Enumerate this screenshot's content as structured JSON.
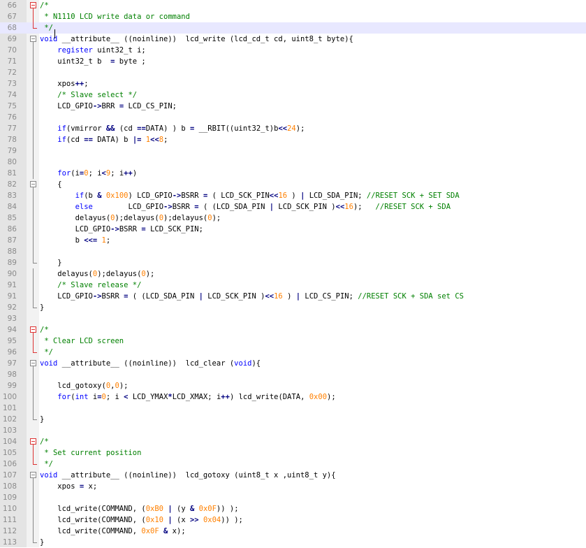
{
  "editor": {
    "lines": [
      {
        "n": "66",
        "fold": "start",
        "tokens": [
          [
            "cm",
            "/*"
          ]
        ]
      },
      {
        "n": "67",
        "fold": "mid",
        "tokens": [
          [
            "cm",
            " * N1110 LCD write data or command"
          ]
        ]
      },
      {
        "n": "68",
        "fold": "end",
        "current": true,
        "tokens": [
          [
            "cm",
            " */"
          ]
        ]
      },
      {
        "n": "69",
        "fold": "start",
        "g": true,
        "tokens": [
          [
            "kw",
            "void"
          ],
          [
            "pl",
            " __attribute__ ((noinline))  lcd_write (lcd_cd_t cd, uint8_t byte){"
          ]
        ]
      },
      {
        "n": "70",
        "fold": "mid",
        "g": true,
        "tokens": [
          [
            "pl",
            "    "
          ],
          [
            "kw",
            "register"
          ],
          [
            "pl",
            " uint32_t i;"
          ]
        ]
      },
      {
        "n": "71",
        "fold": "mid",
        "g": true,
        "tokens": [
          [
            "pl",
            "    uint32_t b  "
          ],
          [
            "op",
            "="
          ],
          [
            "pl",
            " byte ;"
          ]
        ]
      },
      {
        "n": "72",
        "fold": "mid",
        "g": true,
        "tokens": []
      },
      {
        "n": "73",
        "fold": "mid",
        "g": true,
        "tokens": [
          [
            "pl",
            "    xpos"
          ],
          [
            "op",
            "++"
          ],
          [
            "pl",
            ";"
          ]
        ]
      },
      {
        "n": "74",
        "fold": "mid",
        "g": true,
        "tokens": [
          [
            "pl",
            "    "
          ],
          [
            "cm",
            "/* Slave select */"
          ]
        ]
      },
      {
        "n": "75",
        "fold": "mid",
        "g": true,
        "tokens": [
          [
            "pl",
            "    LCD_GPIO"
          ],
          [
            "op",
            "->"
          ],
          [
            "pl",
            "BRR "
          ],
          [
            "op",
            "="
          ],
          [
            "pl",
            " LCD_CS_PIN;"
          ]
        ]
      },
      {
        "n": "76",
        "fold": "mid",
        "g": true,
        "tokens": []
      },
      {
        "n": "77",
        "fold": "mid",
        "g": true,
        "tokens": [
          [
            "pl",
            "    "
          ],
          [
            "kw",
            "if"
          ],
          [
            "pl",
            "(vmirror "
          ],
          [
            "op",
            "&&"
          ],
          [
            "pl",
            " (cd "
          ],
          [
            "op",
            "=="
          ],
          [
            "pl",
            "DATA) ) b "
          ],
          [
            "op",
            "="
          ],
          [
            "pl",
            " __RBIT((uint32_t)b"
          ],
          [
            "op",
            "<<"
          ],
          [
            "num",
            "24"
          ],
          [
            "pl",
            ");"
          ]
        ]
      },
      {
        "n": "78",
        "fold": "mid",
        "g": true,
        "tokens": [
          [
            "pl",
            "    "
          ],
          [
            "kw",
            "if"
          ],
          [
            "pl",
            "(cd "
          ],
          [
            "op",
            "=="
          ],
          [
            "pl",
            " DATA) b "
          ],
          [
            "op",
            "|="
          ],
          [
            "pl",
            " "
          ],
          [
            "num",
            "1"
          ],
          [
            "op",
            "<<"
          ],
          [
            "num",
            "8"
          ],
          [
            "pl",
            ";"
          ]
        ]
      },
      {
        "n": "79",
        "fold": "mid",
        "g": true,
        "tokens": []
      },
      {
        "n": "80",
        "fold": "mid",
        "g": true,
        "tokens": []
      },
      {
        "n": "81",
        "fold": "mid",
        "g": true,
        "tokens": [
          [
            "pl",
            "    "
          ],
          [
            "kw",
            "for"
          ],
          [
            "pl",
            "(i"
          ],
          [
            "op",
            "="
          ],
          [
            "num",
            "0"
          ],
          [
            "pl",
            "; i"
          ],
          [
            "op",
            "<"
          ],
          [
            "num",
            "9"
          ],
          [
            "pl",
            "; i"
          ],
          [
            "op",
            "++"
          ],
          [
            "pl",
            ")"
          ]
        ]
      },
      {
        "n": "82",
        "fold": "start",
        "g": true,
        "tokens": [
          [
            "pl",
            "    {"
          ]
        ]
      },
      {
        "n": "83",
        "fold": "mid",
        "g": true,
        "tokens": [
          [
            "pl",
            "        "
          ],
          [
            "kw",
            "if"
          ],
          [
            "pl",
            "(b "
          ],
          [
            "op",
            "&"
          ],
          [
            "pl",
            " "
          ],
          [
            "num",
            "0x100"
          ],
          [
            "pl",
            ") LCD_GPIO"
          ],
          [
            "op",
            "->"
          ],
          [
            "pl",
            "BSRR "
          ],
          [
            "op",
            "="
          ],
          [
            "pl",
            " ( LCD_SCK_PIN"
          ],
          [
            "op",
            "<<"
          ],
          [
            "num",
            "16"
          ],
          [
            "pl",
            " ) "
          ],
          [
            "op",
            "|"
          ],
          [
            "pl",
            " LCD_SDA_PIN; "
          ],
          [
            "cm",
            "//RESET SCK + SET SDA"
          ]
        ]
      },
      {
        "n": "84",
        "fold": "mid",
        "g": true,
        "tokens": [
          [
            "pl",
            "        "
          ],
          [
            "kw",
            "else"
          ],
          [
            "pl",
            "        LCD_GPIO"
          ],
          [
            "op",
            "->"
          ],
          [
            "pl",
            "BSRR "
          ],
          [
            "op",
            "="
          ],
          [
            "pl",
            " ( (LCD_SDA_PIN "
          ],
          [
            "op",
            "|"
          ],
          [
            "pl",
            " LCD_SCK_PIN )"
          ],
          [
            "op",
            "<<"
          ],
          [
            "num",
            "16"
          ],
          [
            "pl",
            ");   "
          ],
          [
            "cm",
            "//RESET SCK + SDA"
          ]
        ]
      },
      {
        "n": "85",
        "fold": "mid",
        "g": true,
        "tokens": [
          [
            "pl",
            "        delayus("
          ],
          [
            "num",
            "0"
          ],
          [
            "pl",
            ");delayus("
          ],
          [
            "num",
            "0"
          ],
          [
            "pl",
            ");delayus("
          ],
          [
            "num",
            "0"
          ],
          [
            "pl",
            ");"
          ]
        ]
      },
      {
        "n": "86",
        "fold": "mid",
        "g": true,
        "tokens": [
          [
            "pl",
            "        LCD_GPIO"
          ],
          [
            "op",
            "->"
          ],
          [
            "pl",
            "BSRR "
          ],
          [
            "op",
            "="
          ],
          [
            "pl",
            " LCD_SCK_PIN;"
          ]
        ]
      },
      {
        "n": "87",
        "fold": "mid",
        "g": true,
        "tokens": [
          [
            "pl",
            "        b "
          ],
          [
            "op",
            "<<="
          ],
          [
            "pl",
            " "
          ],
          [
            "num",
            "1"
          ],
          [
            "pl",
            ";"
          ]
        ]
      },
      {
        "n": "88",
        "fold": "mid",
        "g": true,
        "tokens": []
      },
      {
        "n": "89",
        "fold": "end",
        "g": true,
        "tokens": [
          [
            "pl",
            "    }"
          ]
        ]
      },
      {
        "n": "90",
        "fold": "mid",
        "g": true,
        "tokens": [
          [
            "pl",
            "    delayus("
          ],
          [
            "num",
            "0"
          ],
          [
            "pl",
            ");delayus("
          ],
          [
            "num",
            "0"
          ],
          [
            "pl",
            ");"
          ]
        ]
      },
      {
        "n": "91",
        "fold": "mid",
        "g": true,
        "tokens": [
          [
            "pl",
            "    "
          ],
          [
            "cm",
            "/* Slave release */"
          ]
        ]
      },
      {
        "n": "91",
        "fold": "mid",
        "g": true,
        "tokens": [
          [
            "pl",
            "    LCD_GPIO"
          ],
          [
            "op",
            "->"
          ],
          [
            "pl",
            "BSRR "
          ],
          [
            "op",
            "="
          ],
          [
            "pl",
            " ( (LCD_SDA_PIN "
          ],
          [
            "op",
            "|"
          ],
          [
            "pl",
            " LCD_SCK_PIN )"
          ],
          [
            "op",
            "<<"
          ],
          [
            "num",
            "16"
          ],
          [
            "pl",
            " ) "
          ],
          [
            "op",
            "|"
          ],
          [
            "pl",
            " LCD_CS_PIN; "
          ],
          [
            "cm",
            "//RESET SCK + SDA set CS"
          ]
        ]
      },
      {
        "n": "92",
        "fold": "end",
        "g": true,
        "tokens": [
          [
            "pl",
            "}"
          ]
        ]
      },
      {
        "n": "93",
        "fold": "none",
        "tokens": []
      },
      {
        "n": "94",
        "fold": "start",
        "tokens": [
          [
            "cm",
            "/*"
          ]
        ]
      },
      {
        "n": "95",
        "fold": "mid",
        "tokens": [
          [
            "cm",
            " * Clear LCD screen"
          ]
        ]
      },
      {
        "n": "96",
        "fold": "end",
        "tokens": [
          [
            "cm",
            " */"
          ]
        ]
      },
      {
        "n": "97",
        "fold": "start",
        "g": true,
        "tokens": [
          [
            "kw",
            "void"
          ],
          [
            "pl",
            " __attribute__ ((noinline))  lcd_clear ("
          ],
          [
            "kw",
            "void"
          ],
          [
            "pl",
            "){"
          ]
        ]
      },
      {
        "n": "98",
        "fold": "mid",
        "g": true,
        "tokens": []
      },
      {
        "n": "99",
        "fold": "mid",
        "g": true,
        "tokens": [
          [
            "pl",
            "    lcd_gotoxy("
          ],
          [
            "num",
            "0"
          ],
          [
            "pl",
            ","
          ],
          [
            "num",
            "0"
          ],
          [
            "pl",
            ");"
          ]
        ]
      },
      {
        "n": "100",
        "fold": "mid",
        "g": true,
        "tokens": [
          [
            "pl",
            "    "
          ],
          [
            "kw",
            "for"
          ],
          [
            "pl",
            "("
          ],
          [
            "kw",
            "int"
          ],
          [
            "pl",
            " i"
          ],
          [
            "op",
            "="
          ],
          [
            "num",
            "0"
          ],
          [
            "pl",
            "; i "
          ],
          [
            "op",
            "<"
          ],
          [
            "pl",
            " LCD_YMAX"
          ],
          [
            "op",
            "*"
          ],
          [
            "pl",
            "LCD_XMAX; i"
          ],
          [
            "op",
            "++"
          ],
          [
            "pl",
            ") lcd_write(DATA, "
          ],
          [
            "num",
            "0x00"
          ],
          [
            "pl",
            ");"
          ]
        ]
      },
      {
        "n": "101",
        "fold": "mid",
        "g": true,
        "tokens": []
      },
      {
        "n": "102",
        "fold": "end",
        "g": true,
        "tokens": [
          [
            "pl",
            "}"
          ]
        ]
      },
      {
        "n": "103",
        "fold": "none",
        "tokens": []
      },
      {
        "n": "104",
        "fold": "start",
        "tokens": [
          [
            "cm",
            "/*"
          ]
        ]
      },
      {
        "n": "105",
        "fold": "mid",
        "tokens": [
          [
            "cm",
            " * Set current position"
          ]
        ]
      },
      {
        "n": "106",
        "fold": "end",
        "tokens": [
          [
            "cm",
            " */"
          ]
        ]
      },
      {
        "n": "107",
        "fold": "start",
        "g": true,
        "tokens": [
          [
            "kw",
            "void"
          ],
          [
            "pl",
            " __attribute__ ((noinline))  lcd_gotoxy (uint8_t x ,uint8_t y){"
          ]
        ]
      },
      {
        "n": "108",
        "fold": "mid",
        "g": true,
        "tokens": [
          [
            "pl",
            "    xpos "
          ],
          [
            "op",
            "="
          ],
          [
            "pl",
            " x;"
          ]
        ]
      },
      {
        "n": "109",
        "fold": "mid",
        "g": true,
        "tokens": []
      },
      {
        "n": "110",
        "fold": "mid",
        "g": true,
        "tokens": [
          [
            "pl",
            "    lcd_write(COMMAND, ("
          ],
          [
            "num",
            "0xB0"
          ],
          [
            "pl",
            " "
          ],
          [
            "op",
            "|"
          ],
          [
            "pl",
            " (y "
          ],
          [
            "op",
            "&"
          ],
          [
            "pl",
            " "
          ],
          [
            "num",
            "0x0F"
          ],
          [
            "pl",
            ")) );"
          ]
        ]
      },
      {
        "n": "111",
        "fold": "mid",
        "g": true,
        "tokens": [
          [
            "pl",
            "    lcd_write(COMMAND, ("
          ],
          [
            "num",
            "0x10"
          ],
          [
            "pl",
            " "
          ],
          [
            "op",
            "|"
          ],
          [
            "pl",
            " (x "
          ],
          [
            "op",
            ">>"
          ],
          [
            "pl",
            " "
          ],
          [
            "num",
            "0x04"
          ],
          [
            "pl",
            ")) );"
          ]
        ]
      },
      {
        "n": "112",
        "fold": "mid",
        "g": true,
        "tokens": [
          [
            "pl",
            "    lcd_write(COMMAND, "
          ],
          [
            "num",
            "0x0F"
          ],
          [
            "pl",
            " "
          ],
          [
            "op",
            "&"
          ],
          [
            "pl",
            " x);"
          ]
        ]
      },
      {
        "n": "113",
        "fold": "end",
        "g": true,
        "tokens": [
          [
            "pl",
            "}"
          ]
        ]
      }
    ]
  }
}
